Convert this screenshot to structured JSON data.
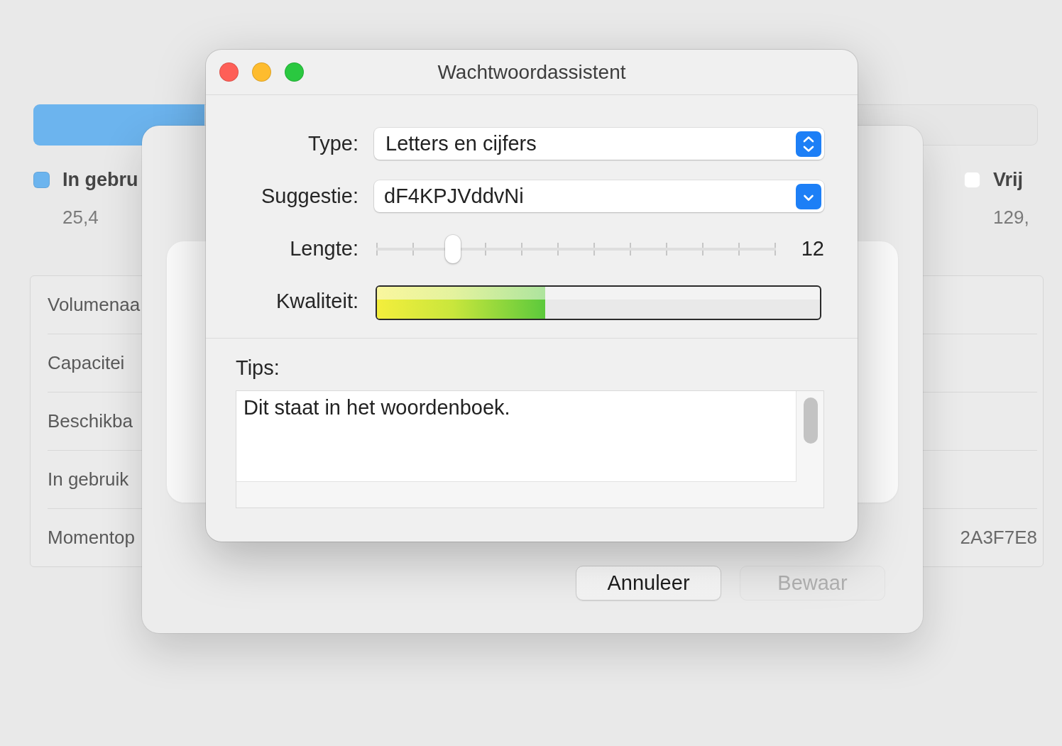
{
  "background_window": {
    "usage_bar": {
      "level": 0.17
    },
    "legend": [
      {
        "label": "In gebru",
        "value": "25,4",
        "color": "#6cb4ee"
      },
      {
        "label": "Vrij",
        "value": "129,",
        "color": "#ffffff"
      }
    ],
    "info_rows": [
      {
        "label": "Volumenaa"
      },
      {
        "label": "Capacitei"
      },
      {
        "label": "Beschikba"
      },
      {
        "label": "In gebruik"
      },
      {
        "label": "Momentop",
        "value": "2A3F7E8"
      }
    ]
  },
  "sheet": {
    "buttons": [
      {
        "label": "Annuleer",
        "disabled": false
      },
      {
        "label": "Bewaar",
        "disabled": true
      }
    ]
  },
  "dialog": {
    "title": "Wachtwoordassistent",
    "fields": [
      {
        "kind": "popup",
        "label": "Type:",
        "value": "Letters en cijfers"
      },
      {
        "kind": "combo",
        "label": "Suggestie:",
        "value": "dF4KPJVddvNi"
      },
      {
        "kind": "slider",
        "label": "Lengte:",
        "level": 0.18,
        "reading": "12"
      },
      {
        "kind": "meter",
        "label": "Kwaliteit:",
        "level": 0.38
      }
    ],
    "tips_label": "Tips:",
    "tips_text": "Dit staat in het woordenboek."
  }
}
